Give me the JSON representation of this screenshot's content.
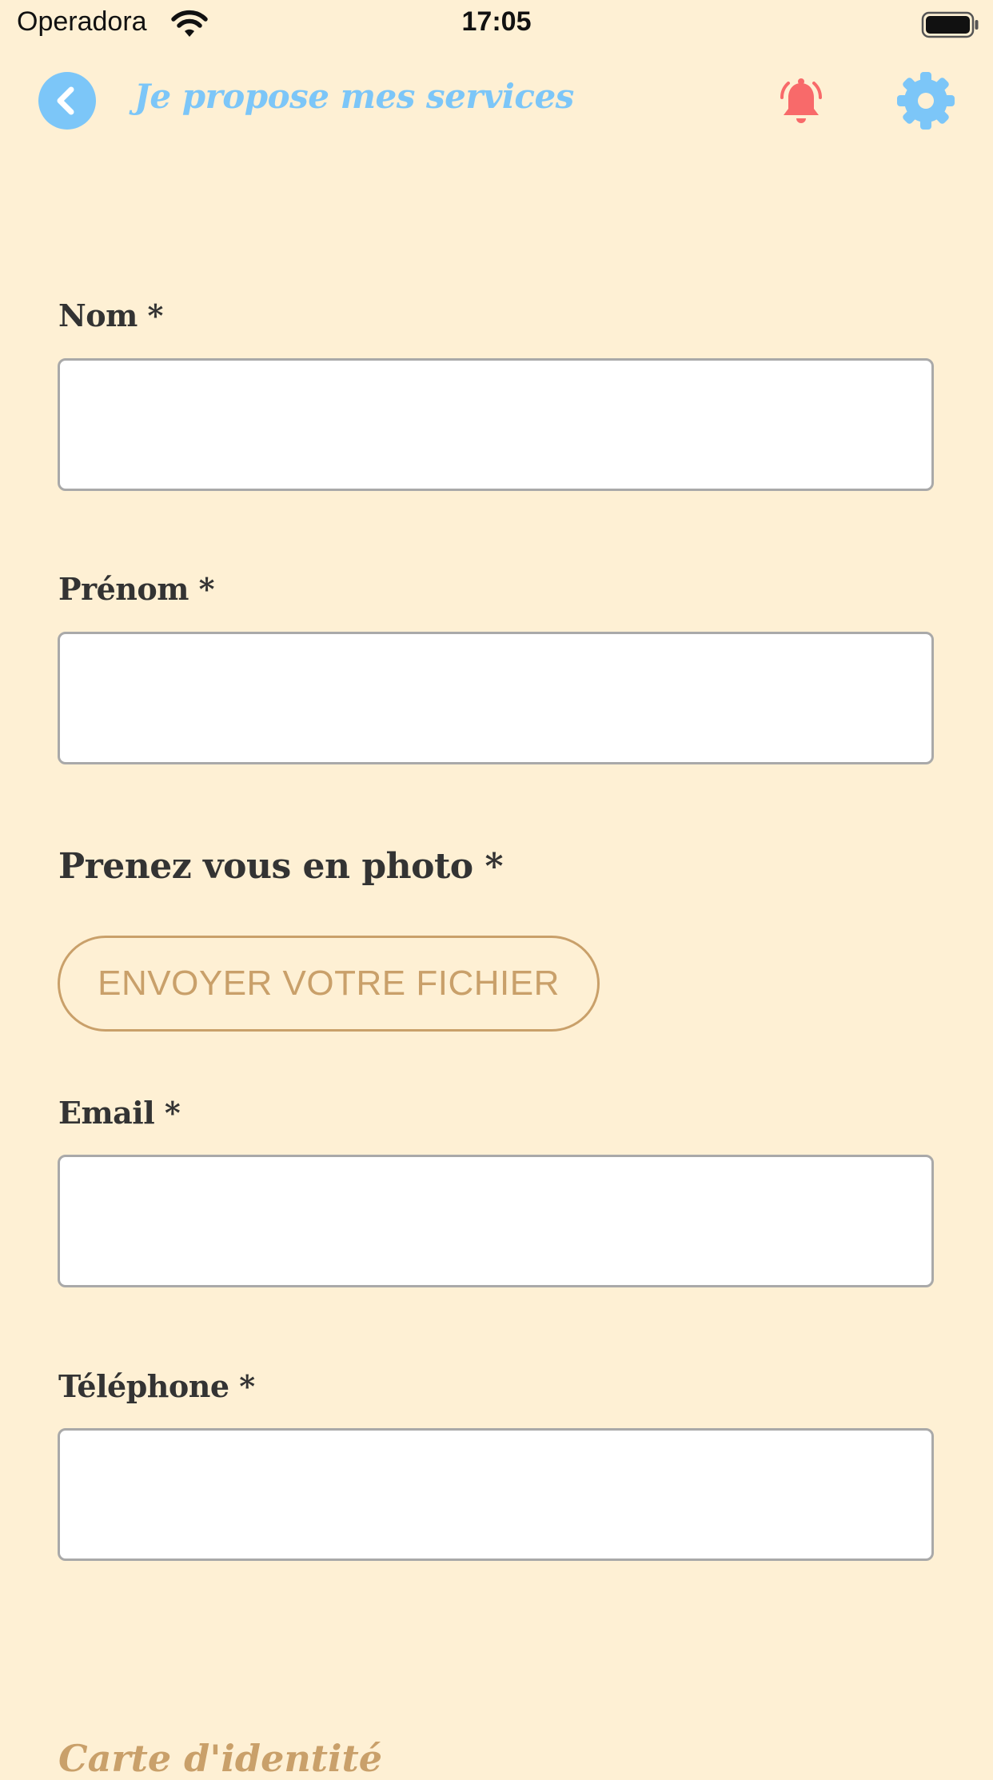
{
  "status_bar": {
    "carrier": "Operadora",
    "time": "17:05"
  },
  "header": {
    "title": "Je propose mes services",
    "back_icon": "chevron-left-icon",
    "notifications_icon": "bell-icon",
    "settings_icon": "gear-icon"
  },
  "form": {
    "nom_label": "Nom *",
    "prenom_label": "Prénom *",
    "photo_label": "Prenez vous en photo *",
    "upload_button_label": "ENVOYER VOTRE FICHIER",
    "email_label": "Email *",
    "telephone_label": "Téléphone *",
    "nom_value": "",
    "prenom_value": "",
    "email_value": "",
    "telephone_value": "",
    "id_card_heading": "Carte d'identité"
  },
  "colors": {
    "background": "#FEF0D4",
    "accent_blue": "#7CC6F8",
    "bell_red": "#F86A6A",
    "gold": "#C9A06A",
    "label_text": "#333333"
  }
}
